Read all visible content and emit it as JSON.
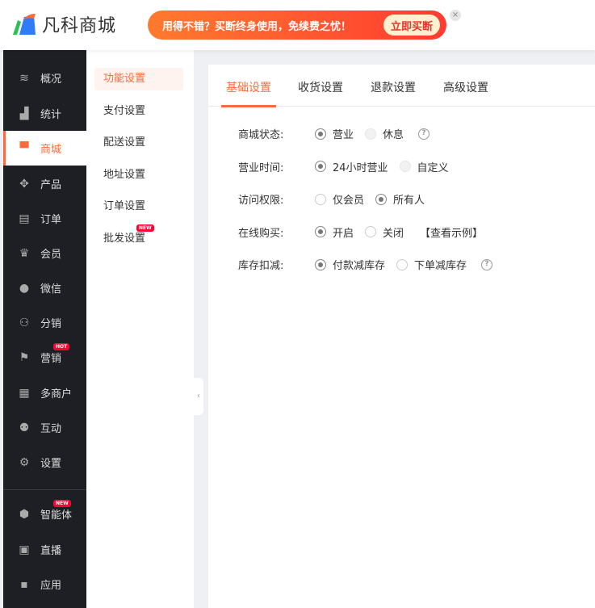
{
  "header": {
    "logo_text": "凡科商城",
    "banner_text": "用得不错？买断终身使用，免续费之忧！",
    "banner_button": "立即买断",
    "close": "×"
  },
  "sidebar": {
    "items": [
      {
        "label": "概况",
        "icon": "layers-icon",
        "glyph": "≋"
      },
      {
        "label": "统计",
        "icon": "chart-icon",
        "glyph": "▟"
      },
      {
        "label": "商城",
        "icon": "shop-bag-icon",
        "glyph": "▀"
      },
      {
        "label": "产品",
        "icon": "grid-icon",
        "glyph": "✥"
      },
      {
        "label": "订单",
        "icon": "clipboard-icon",
        "glyph": "▤"
      },
      {
        "label": "会员",
        "icon": "crown-icon",
        "glyph": "♛"
      },
      {
        "label": "微信",
        "icon": "wechat-icon",
        "glyph": "●"
      },
      {
        "label": "分销",
        "icon": "users-icon",
        "glyph": "⚇"
      },
      {
        "label": "营销",
        "icon": "flag-icon",
        "glyph": "⚑",
        "badge": "HOT"
      },
      {
        "label": "多商户",
        "icon": "store-icon",
        "glyph": "▦"
      },
      {
        "label": "互动",
        "icon": "people-icon",
        "glyph": "⚉"
      },
      {
        "label": "设置",
        "icon": "gear-icon",
        "glyph": "⚙"
      },
      {
        "label": "智能体",
        "icon": "cube-icon",
        "glyph": "⬢",
        "badge": "NEW"
      },
      {
        "label": "直播",
        "icon": "tv-icon",
        "glyph": "▣"
      },
      {
        "label": "应用",
        "icon": "apps-icon",
        "glyph": "▪"
      }
    ],
    "active": "商城"
  },
  "submenu": {
    "items": [
      {
        "label": "功能设置"
      },
      {
        "label": "支付设置"
      },
      {
        "label": "配送设置"
      },
      {
        "label": "地址设置"
      },
      {
        "label": "订单设置"
      },
      {
        "label": "批发设置",
        "badge": "NEW"
      }
    ],
    "active": "功能设置"
  },
  "tabs": [
    {
      "label": "基础设置"
    },
    {
      "label": "收货设置"
    },
    {
      "label": "退款设置"
    },
    {
      "label": "高级设置"
    }
  ],
  "form": [
    {
      "label": "商城状态:",
      "options": [
        {
          "text": "营业",
          "checked": true
        },
        {
          "text": "休息",
          "checked": false,
          "disabled": true
        }
      ],
      "help": true
    },
    {
      "label": "营业时间:",
      "options": [
        {
          "text": "24小时营业",
          "checked": true
        },
        {
          "text": "自定义",
          "checked": false,
          "disabled": true
        }
      ]
    },
    {
      "label": "访问权限:",
      "options": [
        {
          "text": "仅会员",
          "checked": false
        },
        {
          "text": "所有人",
          "checked": true
        }
      ]
    },
    {
      "label": "在线购买:",
      "options": [
        {
          "text": "开启",
          "checked": true
        },
        {
          "text": "关闭",
          "checked": false
        }
      ],
      "link": "【查看示例】"
    },
    {
      "label": "库存扣减:",
      "options": [
        {
          "text": "付款减库存",
          "checked": true
        },
        {
          "text": "下单减库存",
          "checked": false
        }
      ],
      "help": true
    }
  ],
  "colors": {
    "accent": "#ff6a3c",
    "sidebar": "#1e1f24"
  }
}
